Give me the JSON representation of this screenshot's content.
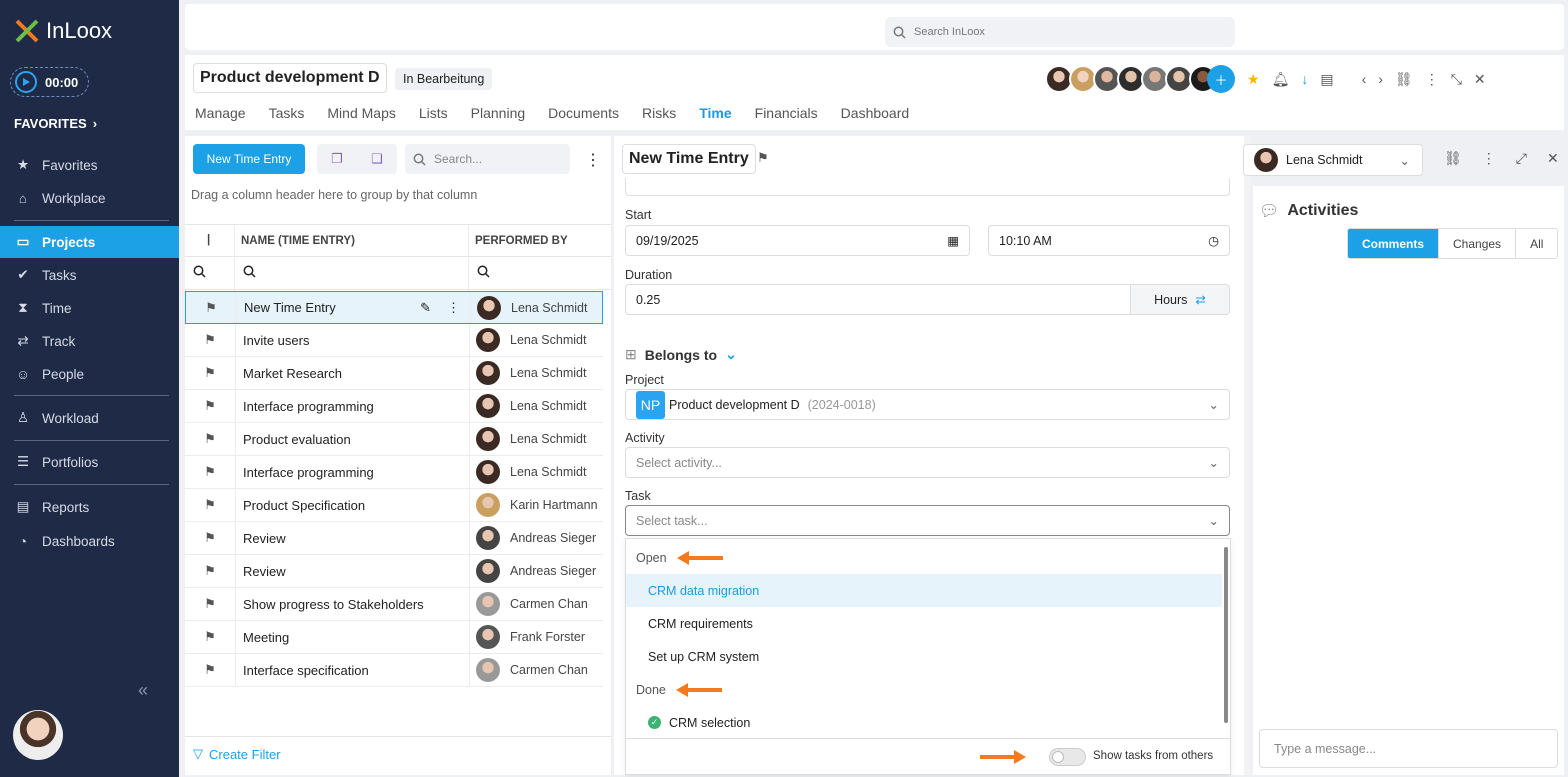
{
  "app": {
    "name": "InLoox",
    "timer": "00:00",
    "favorites": "FAVORITES"
  },
  "nav": [
    {
      "label": "Favorites",
      "icon": "star-icon"
    },
    {
      "label": "Workplace",
      "icon": "home-icon"
    },
    {
      "label": "Projects",
      "icon": "folder-icon"
    },
    {
      "label": "Tasks",
      "icon": "check-icon"
    },
    {
      "label": "Time",
      "icon": "hourglass-icon"
    },
    {
      "label": "Track",
      "icon": "track-icon"
    },
    {
      "label": "People",
      "icon": "people-icon"
    },
    {
      "label": "Workload",
      "icon": "workload-icon"
    },
    {
      "label": "Portfolios",
      "icon": "portfolio-icon"
    },
    {
      "label": "Reports",
      "icon": "report-icon"
    },
    {
      "label": "Dashboards",
      "icon": "dashboard-icon"
    }
  ],
  "search": {
    "placeholder": "Search InLoox"
  },
  "project": {
    "title": "Product development D",
    "status": "In Bearbeitung"
  },
  "tabs": [
    "Manage",
    "Tasks",
    "Mind Maps",
    "Lists",
    "Planning",
    "Documents",
    "Risks",
    "Time",
    "Financials",
    "Dashboard"
  ],
  "left": {
    "new_button": "New Time Entry",
    "search_placeholder": "Search...",
    "group_hint": "Drag a column header here to group by that column",
    "col_name": "NAME (TIME ENTRY)",
    "col_performed": "PERFORMED BY",
    "create_filter": "Create Filter",
    "rows": [
      {
        "name": "New Time Entry",
        "by": "Lena Schmidt"
      },
      {
        "name": "Invite users",
        "by": "Lena Schmidt"
      },
      {
        "name": "Market Research",
        "by": "Lena Schmidt"
      },
      {
        "name": "Interface programming",
        "by": "Lena Schmidt"
      },
      {
        "name": "Product evaluation",
        "by": "Lena Schmidt"
      },
      {
        "name": "Interface programming",
        "by": "Lena Schmidt"
      },
      {
        "name": "Product Specification",
        "by": "Karin Hartmann"
      },
      {
        "name": "Review",
        "by": "Andreas Sieger"
      },
      {
        "name": "Review",
        "by": "Andreas Sieger"
      },
      {
        "name": "Show progress to Stakeholders",
        "by": "Carmen Chan"
      },
      {
        "name": "Meeting",
        "by": "Frank Forster"
      },
      {
        "name": "Interface specification",
        "by": "Carmen Chan"
      }
    ]
  },
  "detail": {
    "title": "New Time Entry",
    "user": "Lena Schmidt",
    "start_label": "Start",
    "start_date": "09/19/2025",
    "start_time": "10:10 AM",
    "duration_label": "Duration",
    "duration": "0.25",
    "unit": "Hours",
    "belongs_to": "Belongs to",
    "project_label": "Project",
    "project_badge": "NP",
    "project_name": "Product development D",
    "project_code": "(2024-0018)",
    "activity_label": "Activity",
    "activity_placeholder": "Select activity...",
    "task_label": "Task",
    "task_placeholder": "Select task...",
    "dropdown": {
      "open_label": "Open",
      "open_items": [
        "CRM data migration",
        "CRM requirements",
        "Set up CRM system"
      ],
      "done_label": "Done",
      "done_items": [
        "CRM selection"
      ],
      "toggle_label": "Show tasks from others"
    }
  },
  "activities": {
    "title": "Activities",
    "tabs": [
      "Comments",
      "Changes",
      "All"
    ],
    "message_placeholder": "Type a message..."
  },
  "colors": {
    "accent": "#1ca0e6",
    "sidebar": "#1e2a46",
    "arrow": "#f47a20"
  }
}
